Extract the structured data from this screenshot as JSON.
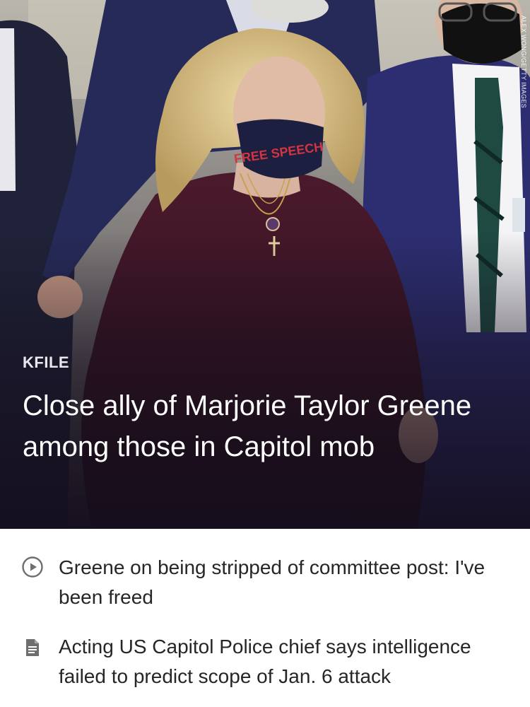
{
  "hero": {
    "photo_credit": "ALEX WONG/GETTY IMAGES",
    "section_label": "KFILE",
    "headline": "Close ally of Marjorie Taylor Greene among those in Capitol mob",
    "mask_text": "FREE SPEECH"
  },
  "related": [
    {
      "type": "video",
      "icon": "play-circle-icon",
      "title": "Greene on being stripped of committee post: I've been freed"
    },
    {
      "type": "article",
      "icon": "document-icon",
      "title": "Acting US Capitol Police chief says intelligence failed to predict scope of Jan. 6 attack"
    }
  ],
  "colors": {
    "headline": "#ffffff",
    "section_label": "#e8e8ee",
    "list_text": "#262626",
    "icon_gray": "#6e6e6e"
  }
}
